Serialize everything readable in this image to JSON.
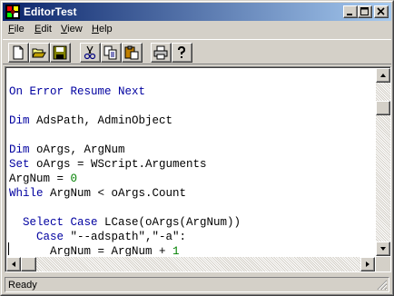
{
  "window": {
    "title": "EditorTest"
  },
  "menu": [
    {
      "label": "File",
      "accel": "F",
      "rest": "ile"
    },
    {
      "label": "Edit",
      "accel": "E",
      "rest": "dit"
    },
    {
      "label": "View",
      "accel": "V",
      "rest": "iew"
    },
    {
      "label": "Help",
      "accel": "H",
      "rest": "elp"
    }
  ],
  "toolbar": {
    "buttons": [
      "new-file-icon",
      "open-folder-icon",
      "save-disk-icon",
      "cut-scissors-icon",
      "copy-icon",
      "paste-clipboard-icon",
      "print-icon",
      "help-question-icon"
    ]
  },
  "code": {
    "lines": [
      [],
      [
        {
          "t": "On Error Resume Next",
          "c": "kw"
        }
      ],
      [],
      [
        {
          "t": "Dim",
          "c": "kw"
        },
        {
          "t": " AdsPath, AdminObject",
          "c": ""
        }
      ],
      [],
      [
        {
          "t": "Dim",
          "c": "kw"
        },
        {
          "t": " oArgs, ArgNum",
          "c": ""
        }
      ],
      [
        {
          "t": "Set",
          "c": "kw"
        },
        {
          "t": " oArgs = WScript.Arguments",
          "c": ""
        }
      ],
      [
        {
          "t": "ArgNum = ",
          "c": ""
        },
        {
          "t": "0",
          "c": "num"
        }
      ],
      [
        {
          "t": "While",
          "c": "kw"
        },
        {
          "t": " ArgNum < oArgs.Count",
          "c": ""
        }
      ],
      [],
      [
        {
          "t": "  ",
          "c": ""
        },
        {
          "t": "Select Case",
          "c": "kw"
        },
        {
          "t": " LCase(oArgs(ArgNum))",
          "c": ""
        }
      ],
      [
        {
          "t": "    ",
          "c": ""
        },
        {
          "t": "Case",
          "c": "kw"
        },
        {
          "t": " \"--adspath\",\"-a\":",
          "c": ""
        }
      ],
      [
        {
          "t": "      ArgNum = ArgNum + ",
          "c": ""
        },
        {
          "t": "1",
          "c": "num"
        }
      ]
    ]
  },
  "status": {
    "text": "Ready"
  },
  "colors": {
    "keyword": "#0000a0",
    "number": "#008000",
    "titlebar_start": "#0a246a",
    "titlebar_end": "#a6caf0"
  }
}
